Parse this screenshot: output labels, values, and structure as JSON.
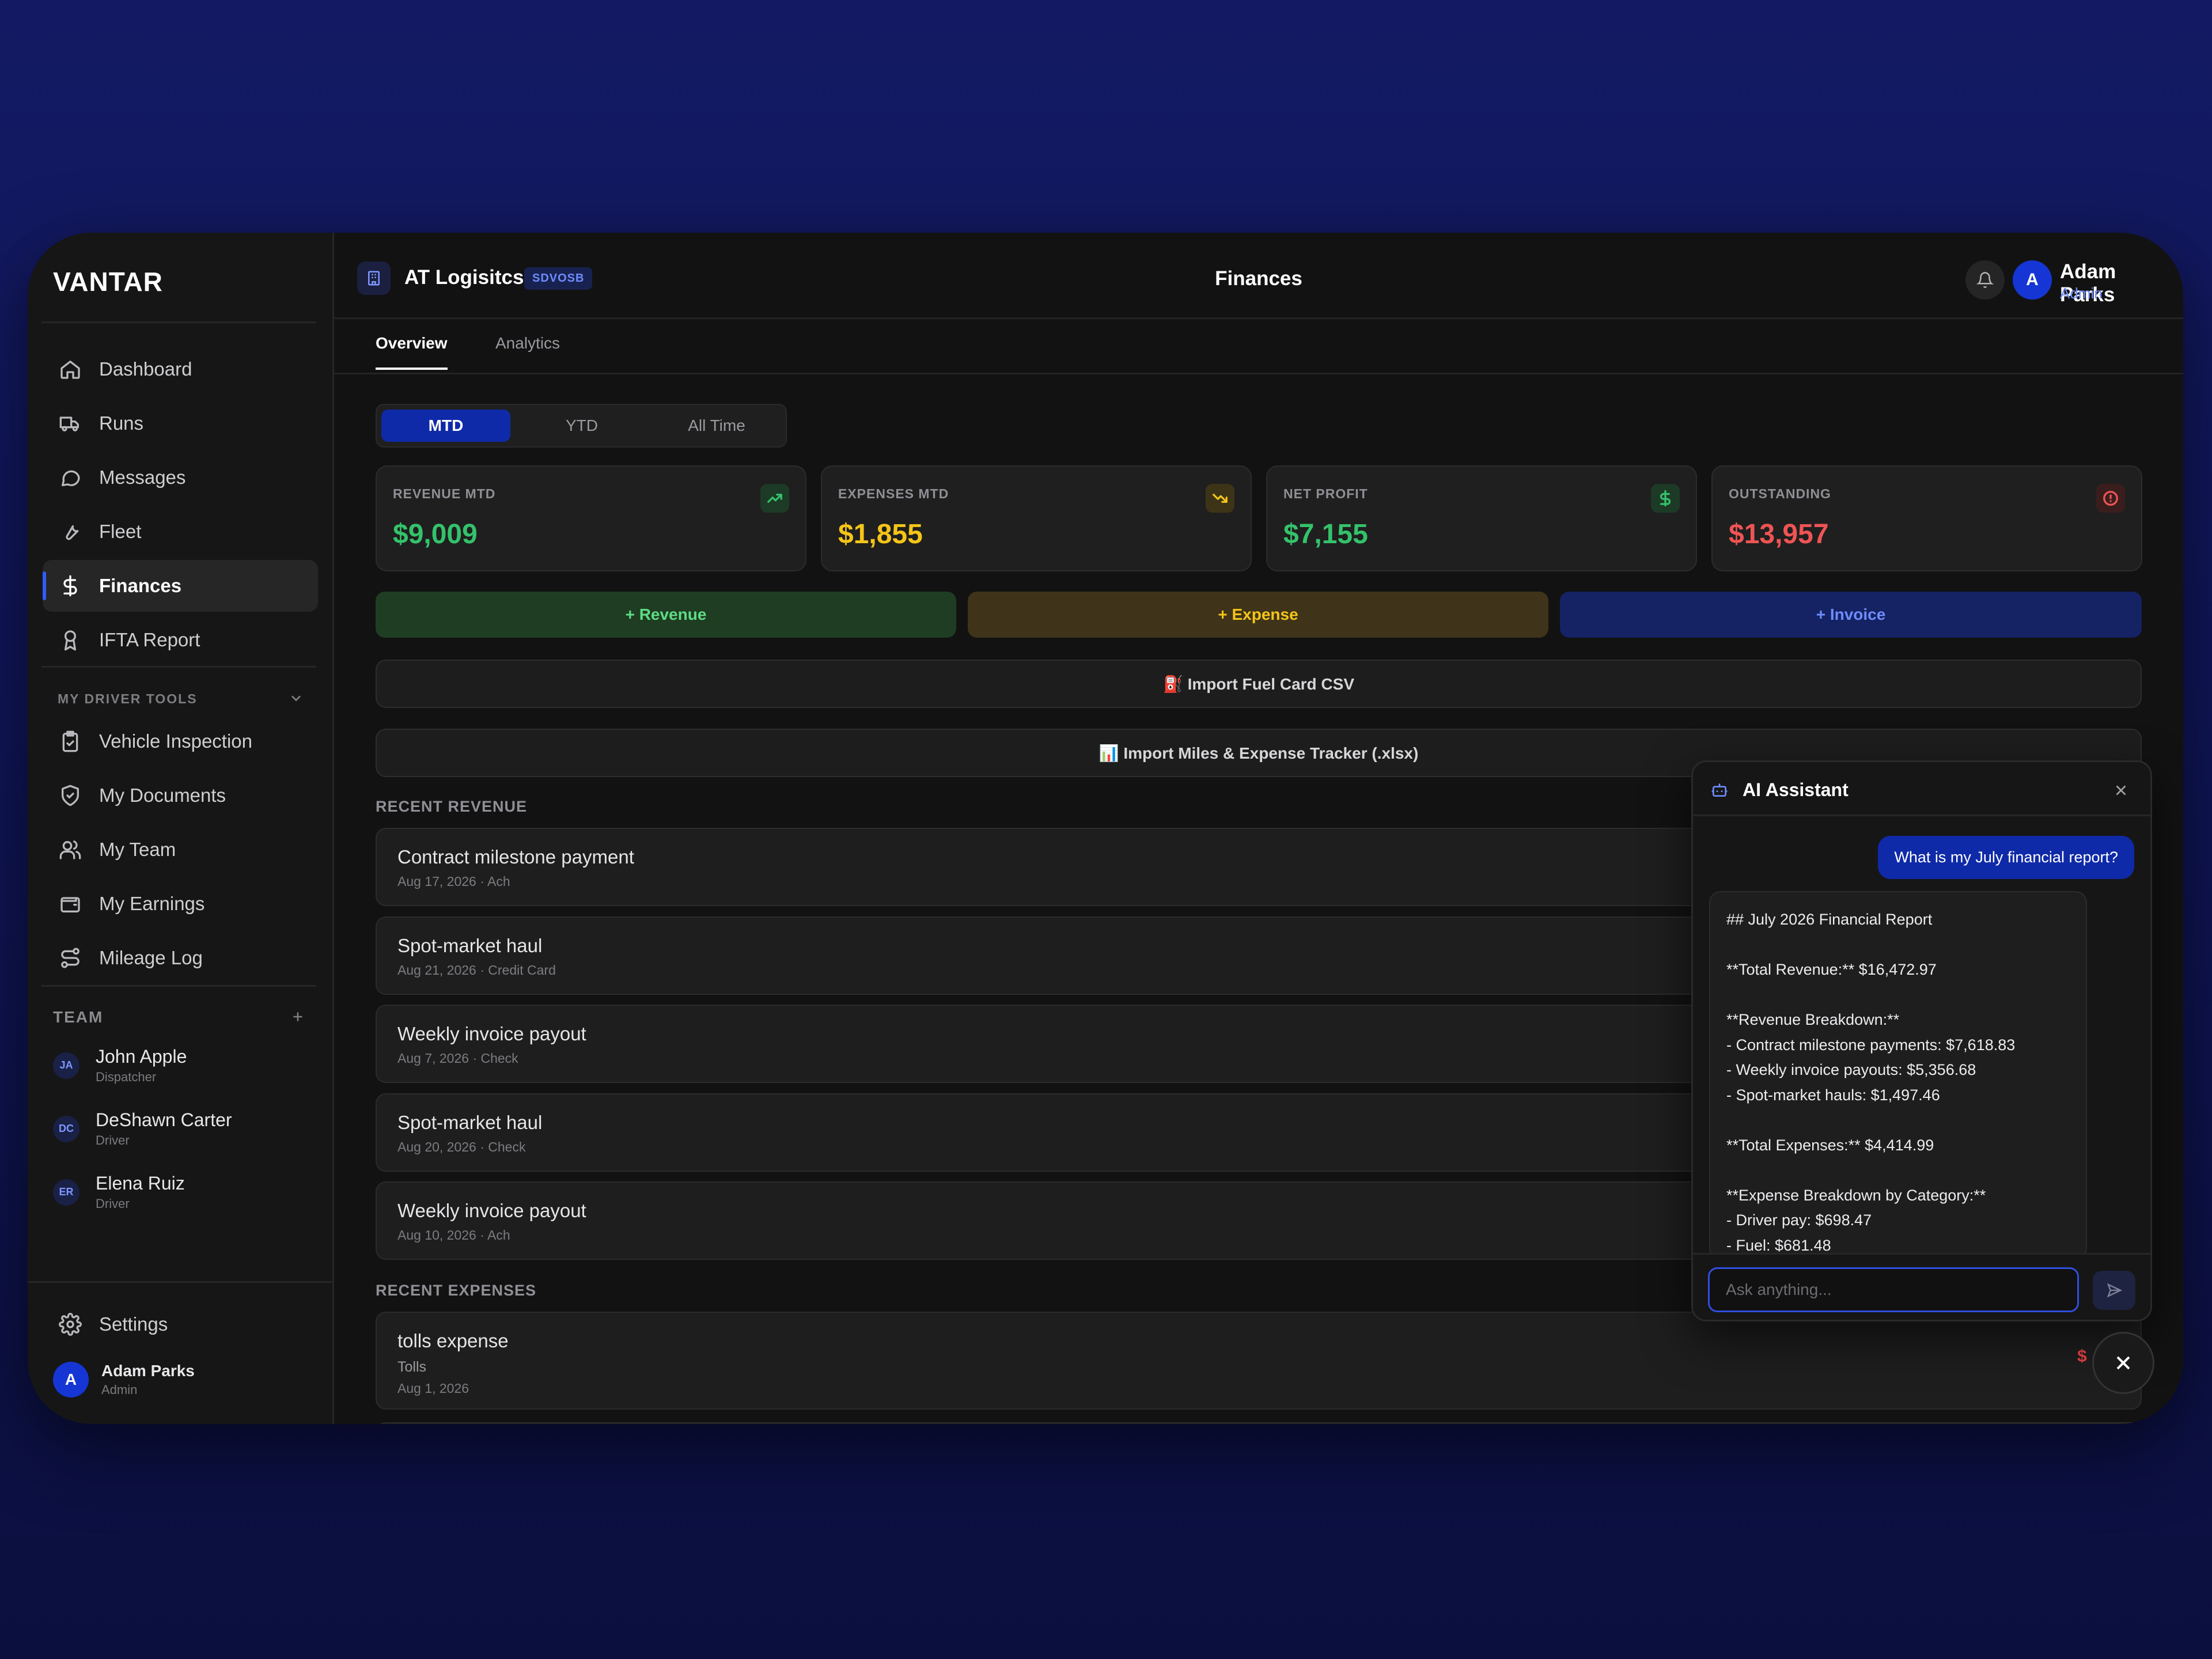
{
  "app": {
    "logo": "VANTAR"
  },
  "sidebar": {
    "nav": [
      {
        "label": "Dashboard",
        "icon": "home-icon"
      },
      {
        "label": "Runs",
        "icon": "truck-icon"
      },
      {
        "label": "Messages",
        "icon": "message-icon"
      },
      {
        "label": "Fleet",
        "icon": "wrench-icon"
      },
      {
        "label": "Finances",
        "icon": "dollar-icon",
        "active": true
      },
      {
        "label": "IFTA Report",
        "icon": "badge-icon"
      }
    ],
    "driver_tools_label": "MY DRIVER TOOLS",
    "driver_tools": [
      {
        "label": "Vehicle Inspection",
        "icon": "clipboard-check-icon"
      },
      {
        "label": "My Documents",
        "icon": "shield-check-icon"
      },
      {
        "label": "My Team",
        "icon": "users-icon"
      },
      {
        "label": "My Earnings",
        "icon": "wallet-icon"
      },
      {
        "label": "Mileage Log",
        "icon": "route-icon"
      }
    ],
    "team_label": "TEAM",
    "team": [
      {
        "initials": "JA",
        "name": "John Apple",
        "role": "Dispatcher"
      },
      {
        "initials": "DC",
        "name": "DeShawn Carter",
        "role": "Driver"
      },
      {
        "initials": "ER",
        "name": "Elena Ruiz",
        "role": "Driver"
      }
    ],
    "settings_label": "Settings",
    "user": {
      "initial": "A",
      "name": "Adam Parks",
      "role": "Admin"
    }
  },
  "header": {
    "org_name": "AT Logisitcs",
    "org_badge": "SDVOSB",
    "page_title": "Finances",
    "user": {
      "initial": "A",
      "name": "Adam Parks",
      "role": "Admin"
    }
  },
  "tabs": [
    {
      "label": "Overview",
      "active": true
    },
    {
      "label": "Analytics",
      "active": false
    }
  ],
  "period": {
    "options": [
      "MTD",
      "YTD",
      "All Time"
    ],
    "selected": "MTD"
  },
  "kpis": [
    {
      "label": "REVENUE MTD",
      "value": "$9,009",
      "color": "#34c26b",
      "icon": "trending-up-icon"
    },
    {
      "label": "EXPENSES MTD",
      "value": "$1,855",
      "color": "#f5c518",
      "icon": "trending-down-icon"
    },
    {
      "label": "NET PROFIT",
      "value": "$7,155",
      "color": "#34c26b",
      "icon": "dollar-icon"
    },
    {
      "label": "OUTSTANDING",
      "value": "$13,957",
      "color": "#ef5454",
      "icon": "alert-circle-icon"
    }
  ],
  "actions": {
    "revenue": "+ Revenue",
    "expense": "+ Expense",
    "invoice": "+ Invoice",
    "import_fuel": "⛽ Import Fuel Card CSV",
    "import_miles": "📊 Import Miles & Expense Tracker (.xlsx)"
  },
  "recent_revenue": {
    "heading": "RECENT REVENUE",
    "items": [
      {
        "title": "Contract milestone payment",
        "meta": "Aug 17, 2026 · Ach"
      },
      {
        "title": "Spot-market haul",
        "meta": "Aug 21, 2026 · Credit Card"
      },
      {
        "title": "Weekly invoice payout",
        "meta": "Aug 7, 2026 · Check"
      },
      {
        "title": "Spot-market haul",
        "meta": "Aug 20, 2026 · Check"
      },
      {
        "title": "Weekly invoice payout",
        "meta": "Aug 10, 2026 · Ach"
      }
    ]
  },
  "recent_expenses": {
    "heading": "RECENT EXPENSES",
    "items": [
      {
        "title": "tolls expense",
        "category": "Tolls",
        "date": "Aug 1, 2026",
        "amount_peek": "$"
      }
    ]
  },
  "assistant": {
    "title": "AI Assistant",
    "user_message": "What is my July financial report?",
    "bot_message": "## July 2026 Financial Report\n\n**Total Revenue:** $16,472.97\n\n**Revenue Breakdown:**\n- Contract milestone payments: $7,618.83\n- Weekly invoice payouts: $5,356.68\n- Spot-market hauls: $1,497.46\n\n**Total Expenses:** $4,414.99\n\n**Expense Breakdown by Category:**\n- Driver pay: $698.47\n- Fuel: $681.48",
    "input_placeholder": "Ask anything...",
    "input_value": ""
  }
}
